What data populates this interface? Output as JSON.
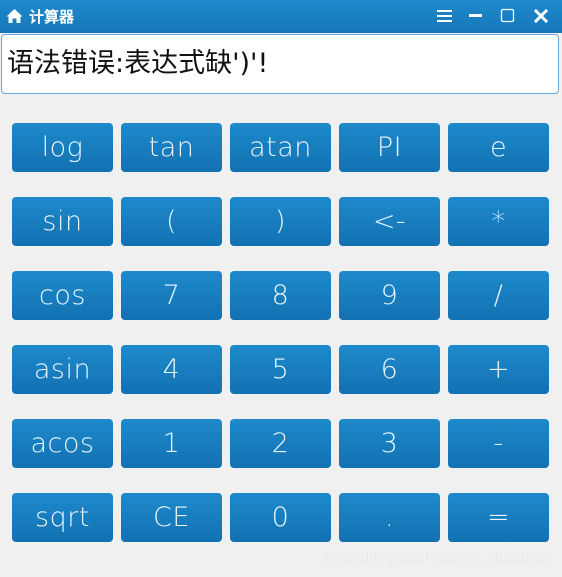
{
  "window": {
    "title": "计算器",
    "icons": {
      "app": "home-icon",
      "menu": "hamburger-menu-icon",
      "minimize": "minimize-icon",
      "maximize": "maximize-icon",
      "close": "close-icon"
    }
  },
  "display": {
    "value": "语法错误:表达式缺')'!"
  },
  "keypad": {
    "rows": [
      [
        "log",
        "tan",
        "atan",
        "PI",
        "e"
      ],
      [
        "sin",
        "(",
        ")",
        "<-",
        "*"
      ],
      [
        "cos",
        "7",
        "8",
        "9",
        "/"
      ],
      [
        "asin",
        "4",
        "5",
        "6",
        "+"
      ],
      [
        "acos",
        "1",
        "2",
        "3",
        "-"
      ],
      [
        "sqrt",
        "CE",
        "0",
        ".",
        "="
      ]
    ]
  },
  "watermark": "https://blog.csdn.net/qq_46068864",
  "colors": {
    "accent": "#1a80c3",
    "background": "#f0f0f0"
  }
}
